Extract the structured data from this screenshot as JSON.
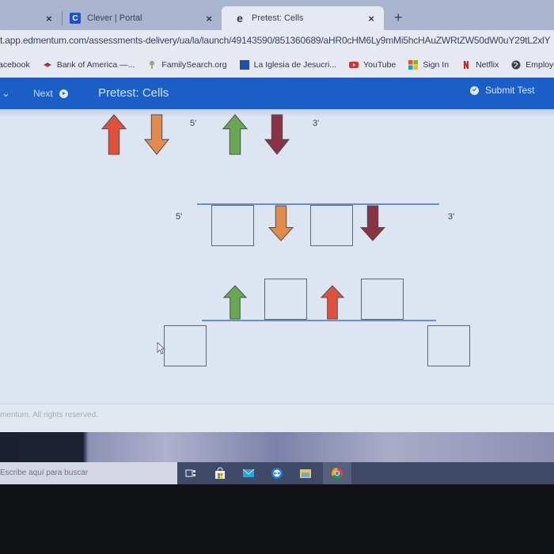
{
  "browser": {
    "tabs": [
      {
        "title": "Clever | Portal",
        "icon": "clever-icon",
        "active": false
      },
      {
        "title": "Pretest: Cells",
        "icon": "edmentum-icon",
        "active": true
      }
    ],
    "new_tab_label": "+",
    "close_label": "×",
    "url": "t.app.edmentum.com/assessments-delivery/ua/la/launch/49143590/851360689/aHR0cHM6Ly9mMi5hcHAuZWRtZW50dW0uY29tL2xlY",
    "bookmarks": [
      {
        "label": "acebook",
        "icon": "facebook-icon"
      },
      {
        "label": "Bank of America —...",
        "icon": "bank-of-america-icon"
      },
      {
        "label": "FamilySearch.org",
        "icon": "familysearch-icon"
      },
      {
        "label": "La Iglesia de Jesucri...",
        "icon": "church-icon"
      },
      {
        "label": "YouTube",
        "icon": "youtube-icon"
      },
      {
        "label": "Sign In",
        "icon": "microsoft-icon"
      },
      {
        "label": "Netflix",
        "icon": "netflix-icon"
      },
      {
        "label": "Employee Po",
        "icon": "globe-icon"
      }
    ]
  },
  "app": {
    "menu_icon": "chevron-down-icon",
    "next_label": "Next",
    "title": "Pretest: Cells",
    "submit_label": "Submit Test",
    "brand_color": "#1b5ec7"
  },
  "question": {
    "palette": {
      "labels": {
        "five_prime": "5'",
        "three_prime": "3'"
      },
      "arrows": [
        {
          "name": "red-up-arrow",
          "direction": "up",
          "color": "#e0503a"
        },
        {
          "name": "orange-down-arrow",
          "direction": "down",
          "color": "#e38b4d"
        },
        {
          "name": "green-up-arrow",
          "direction": "up",
          "color": "#6aa84f"
        },
        {
          "name": "maroon-down-arrow",
          "direction": "down",
          "color": "#8a3345"
        }
      ]
    },
    "top_strand": {
      "left_label": "5'",
      "right_label": "3'",
      "items": [
        {
          "type": "slot"
        },
        {
          "type": "arrow",
          "direction": "down",
          "color": "#e38b4d"
        },
        {
          "type": "slot"
        },
        {
          "type": "arrow",
          "direction": "down",
          "color": "#8a3345"
        }
      ]
    },
    "bottom_strand": {
      "items": [
        {
          "type": "arrow",
          "direction": "up",
          "color": "#6aa84f"
        },
        {
          "type": "slot"
        },
        {
          "type": "arrow",
          "direction": "up",
          "color": "#e0503a"
        },
        {
          "type": "slot"
        }
      ],
      "end_slots": [
        "left",
        "right"
      ]
    }
  },
  "footer": {
    "copyright": "mentum. All rights reserved."
  },
  "taskbar": {
    "search_placeholder": "Escribe aquí para buscar",
    "icons": [
      "task-view-icon",
      "store-icon",
      "mail-icon",
      "teamviewer-icon",
      "file-explorer-icon",
      "chrome-icon"
    ]
  }
}
